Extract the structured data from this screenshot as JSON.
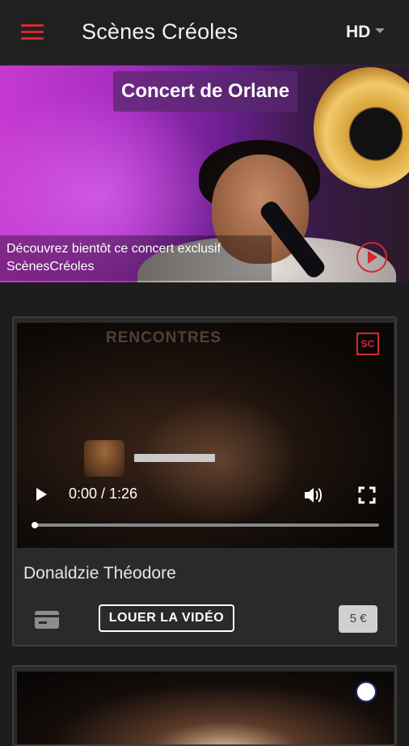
{
  "appbar": {
    "title": "Scènes Créoles",
    "quality": "HD"
  },
  "banner": {
    "title": "Concert de Orlane",
    "caption_line1": "Découvrez bientôt ce concert exclusif",
    "caption_line2": "ScènesCréoles"
  },
  "card1": {
    "video_logo": "SC",
    "video_sign": "RENCONTRES",
    "player": {
      "time": "0:00 / 1:26",
      "progress": 0.0
    },
    "artist": "Donaldzie Théodore",
    "rent_label": "LOUER LA VIDÉO",
    "price": "5 €"
  },
  "colors": {
    "accent": "#d9262f",
    "background": "#1d1d1d",
    "card": "#2a2a2a"
  }
}
